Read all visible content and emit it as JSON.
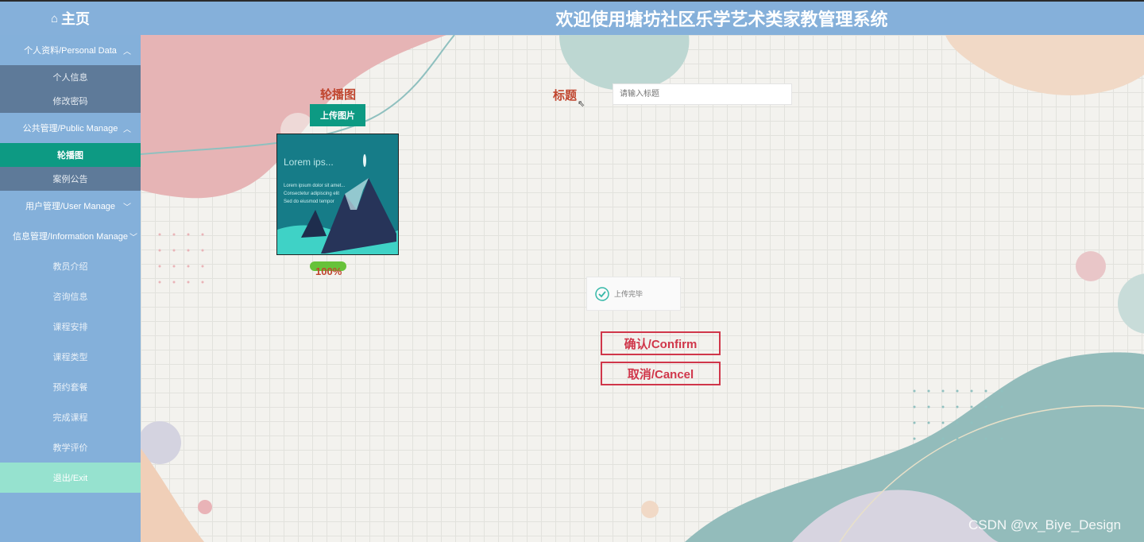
{
  "header": {
    "home_label": "主页",
    "title": "欢迎使用塘坊社区乐学艺术类家教管理系统"
  },
  "sidebar": {
    "groups": [
      {
        "label": "个人资料/Personal Data",
        "items": [
          "个人信息",
          "修改密码"
        ]
      },
      {
        "label": "公共管理/Public Manage",
        "items": [
          "轮播图",
          "案例公告"
        ]
      }
    ],
    "collapsed": [
      "用户管理/User Manage",
      "信息管理/Information Manage"
    ],
    "plain_items": [
      "教员介绍",
      "咨询信息",
      "课程安排",
      "课程类型",
      "预约套餐",
      "完成课程",
      "教学评价"
    ],
    "exit_label": "退出/Exit"
  },
  "form": {
    "carousel_label": "轮播图",
    "upload_label": "上传图片",
    "thumbnail": {
      "title": "Lorem ips...",
      "lines": [
        "Lorem ipsum dolor sit amet...",
        "Consectetur adipiscing elit",
        "Sed do eiusmod tempor"
      ]
    },
    "progress": {
      "value": 100,
      "text": "100%"
    },
    "title_label": "标题",
    "title_placeholder": "请输入标题",
    "toast_text": "上传完毕",
    "confirm_label": "确认/Confirm",
    "cancel_label": "取消/Cancel"
  },
  "watermark": "CSDN @vx_Biye_Design",
  "colors": {
    "header": "#85b0da",
    "sidebar": "#84b0da",
    "submenu": "#5e7a99",
    "active": "#0d9a83",
    "exit": "#96e2cf",
    "label": "#c0462f",
    "button_outline": "#d0364a",
    "progress": "#67c23a"
  },
  "icons": [
    "home-icon",
    "chevron-up-icon",
    "chevron-down-icon",
    "cursor-icon",
    "check-circle-icon"
  ]
}
